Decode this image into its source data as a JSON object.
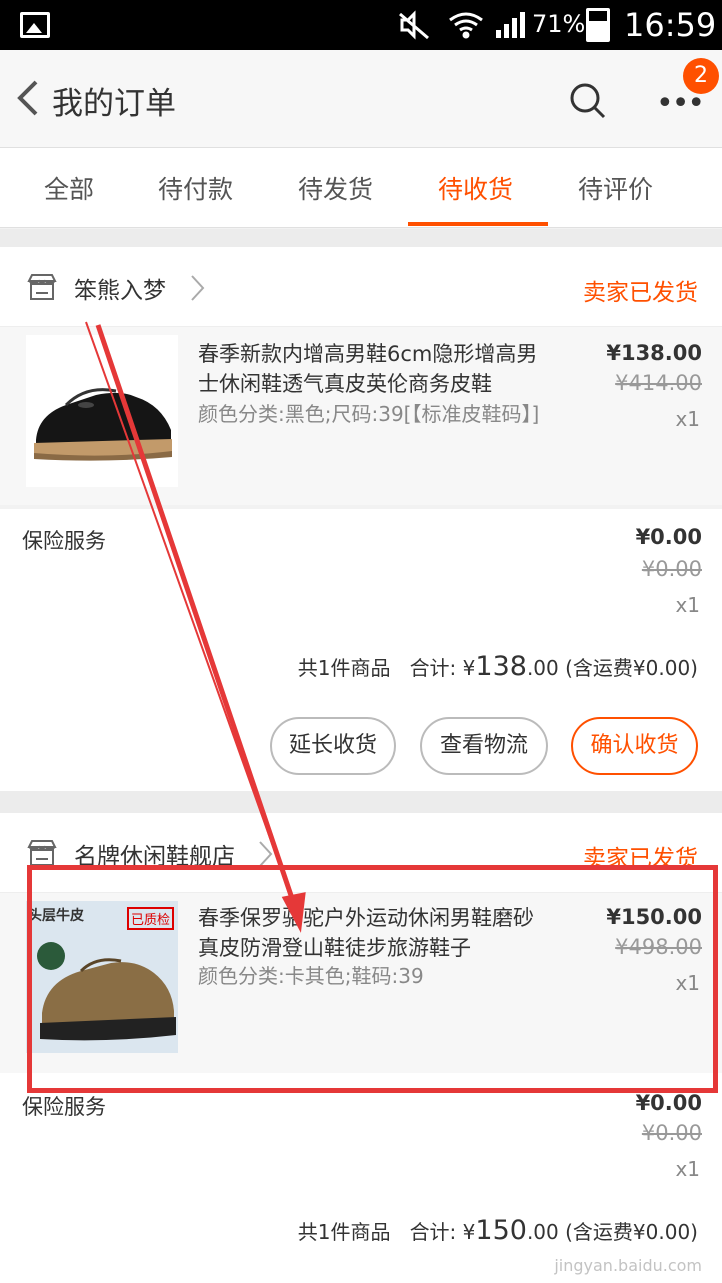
{
  "status_bar": {
    "battery": "71%",
    "time": "16:59"
  },
  "header": {
    "title": "我的订单",
    "badge": "2"
  },
  "tabs": [
    {
      "label": "全部"
    },
    {
      "label": "待付款"
    },
    {
      "label": "待发货"
    },
    {
      "label": "待收货",
      "active": true
    },
    {
      "label": "待评价"
    }
  ],
  "orders": [
    {
      "shop": "笨熊入梦",
      "status": "卖家已发货",
      "item": {
        "title": "春季新款内增高男鞋6cm隐形增高男士休闲鞋透气真皮英伦商务皮鞋",
        "spec": "颜色分类:黑色;尺码:39[【标准皮鞋码】]",
        "price": "¥138.00",
        "old_price": "¥414.00",
        "qty": "x1"
      },
      "insurance": {
        "label": "保险服务",
        "price": "¥0.00",
        "old_price": "¥0.00",
        "qty": "x1"
      },
      "summary": {
        "count": "共1件商品",
        "total_label": "合计:",
        "currency": "¥",
        "total_int": "138",
        "total_dec": ".00",
        "shipping": "(含运费¥0.00)"
      },
      "buttons": [
        "延长收货",
        "查看物流",
        "确认收货"
      ]
    },
    {
      "shop": "名牌休闲鞋舰店",
      "status": "卖家已发货",
      "item": {
        "title": "春季保罗骆驼户外运动休闲男鞋磨砂真皮防滑登山鞋徒步旅游鞋子",
        "spec": "颜色分类:卡其色;鞋码:39",
        "price": "¥150.00",
        "old_price": "¥498.00",
        "qty": "x1",
        "thumb_text_1": "头层牛皮",
        "thumb_text_2": "已质检"
      },
      "insurance": {
        "label": "保险服务",
        "price": "¥0.00",
        "old_price": "¥0.00",
        "qty": "x1"
      },
      "summary": {
        "count": "共1件商品",
        "total_label": "合计:",
        "currency": "¥",
        "total_int": "150",
        "total_dec": ".00",
        "shipping": "(含运费¥0.00)"
      }
    }
  ],
  "watermark": "jingyan.baidu.com",
  "colors": {
    "accent": "#ff5000",
    "annotation": "#e53838"
  }
}
